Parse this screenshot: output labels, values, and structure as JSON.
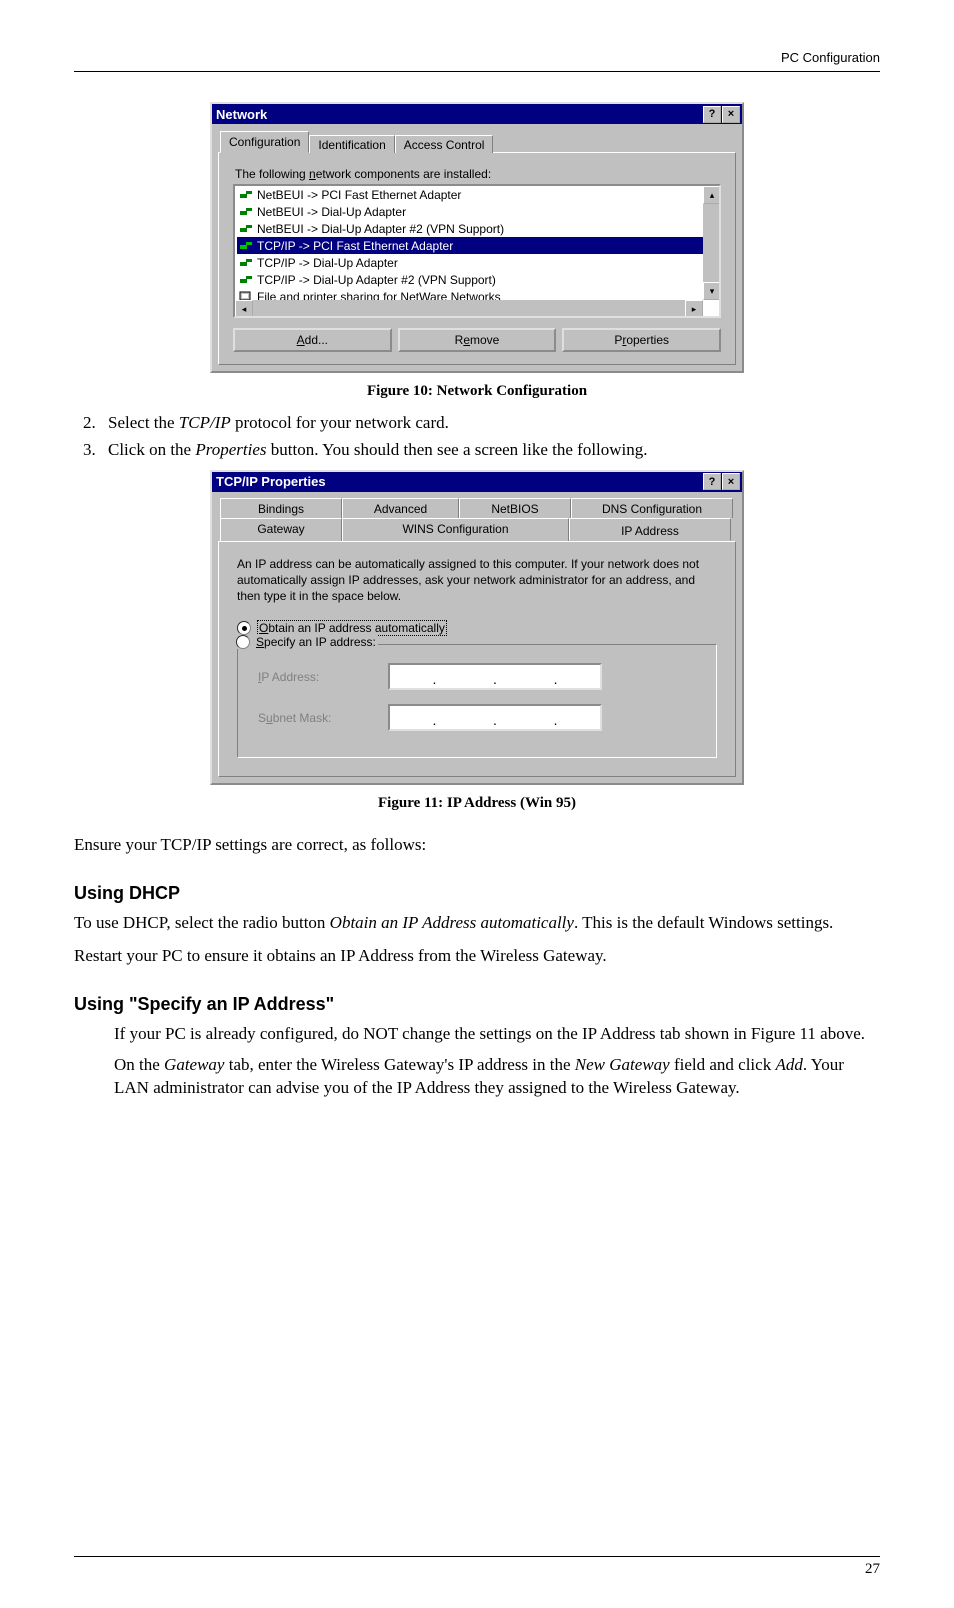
{
  "header": {
    "right": "PC Configuration"
  },
  "dialog1": {
    "title": "Network",
    "tabs": [
      "Configuration",
      "Identification",
      "Access Control"
    ],
    "list_label_pre": "The following ",
    "list_label_under": "n",
    "list_label_post": "etwork components are installed:",
    "items": [
      "NetBEUI -> PCI Fast Ethernet Adapter",
      "NetBEUI -> Dial-Up Adapter",
      "NetBEUI -> Dial-Up Adapter #2 (VPN Support)",
      "TCP/IP -> PCI Fast Ethernet Adapter",
      "TCP/IP -> Dial-Up Adapter",
      "TCP/IP -> Dial-Up Adapter #2 (VPN Support)",
      "File and printer sharing for NetWare Networks"
    ],
    "selected_index": 3,
    "buttons": {
      "add": "Add...",
      "remove": "Remove",
      "properties": "Properties"
    }
  },
  "caption1": "Figure 10: Network Configuration",
  "steps": {
    "s2_pre": "Select the ",
    "s2_em": "TCP/IP",
    "s2_post": " protocol for your network card.",
    "s3_pre": "Click on the ",
    "s3_em": "Properties",
    "s3_post": " button. You should then see a screen like the following."
  },
  "dialog2": {
    "title": "TCP/IP Properties",
    "tabs_row1": [
      "Bindings",
      "Advanced",
      "NetBIOS",
      "DNS Configuration"
    ],
    "tabs_row2": [
      "Gateway",
      "WINS Configuration",
      "IP Address"
    ],
    "info": "An IP address can be automatically assigned to this computer. If your network does not automatically assign IP addresses, ask your network administrator for an address, and then type it in the space below.",
    "radio_auto_under": "O",
    "radio_auto_rest": "btain an IP address automatically",
    "radio_spec_under": "S",
    "radio_spec_rest": "pecify an IP address:",
    "ip_label_under": "I",
    "ip_label_rest": "P Address:",
    "mask_label_pre": "S",
    "mask_label_under": "u",
    "mask_label_rest": "bnet Mask:"
  },
  "caption2": "Figure 11: IP Address (Win 95)",
  "para_ensure": "Ensure your TCP/IP settings are correct, as follows:",
  "heading_dhcp": "Using DHCP",
  "para_dhcp_pre": "To use DHCP, select the radio button ",
  "para_dhcp_em": "Obtain an IP Address automatically",
  "para_dhcp_post": ". This is the default Windows settings.",
  "para_restart": "Restart your PC to ensure it obtains an IP Address from the Wireless Gateway.",
  "heading_specify": "Using \"Specify an IP Address\"",
  "para_spec1": "If your PC is already configured, do NOT change the settings on the IP Address tab shown in Figure 11 above.",
  "para_spec2_pre": "On the ",
  "para_spec2_em1": "Gateway",
  "para_spec2_mid": " tab, enter the Wireless Gateway's IP address in the ",
  "para_spec2_em2": "New Gateway",
  "para_spec2_mid2": " field and click ",
  "para_spec2_em3": "Add",
  "para_spec2_post": ". Your LAN administrator can advise you of the IP Address they assigned to the Wireless Gateway.",
  "pagenum": "27"
}
